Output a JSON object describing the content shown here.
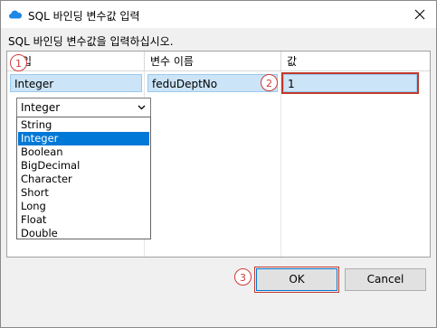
{
  "window": {
    "title": "SQL 바인딩 변수값 입력"
  },
  "instruction": "SQL 바인딩 변수값을 입력하십시오.",
  "table": {
    "columns": [
      "입",
      "변수 이름",
      "값"
    ],
    "row": {
      "type": "Integer",
      "name": "feduDeptNo",
      "value": "1"
    }
  },
  "markers": [
    "1",
    "2",
    "3"
  ],
  "type_dropdown": {
    "selected": "Integer",
    "options": [
      "String",
      "Integer",
      "Boolean",
      "BigDecimal",
      "Character",
      "Short",
      "Long",
      "Float",
      "Double"
    ]
  },
  "buttons": {
    "ok": "OK",
    "cancel": "Cancel"
  },
  "colors": {
    "selection": "#0078d7",
    "cell_highlight": "#cce4f7",
    "annotation_red": "#d23b3b",
    "app_icon": "#1e88e5"
  }
}
